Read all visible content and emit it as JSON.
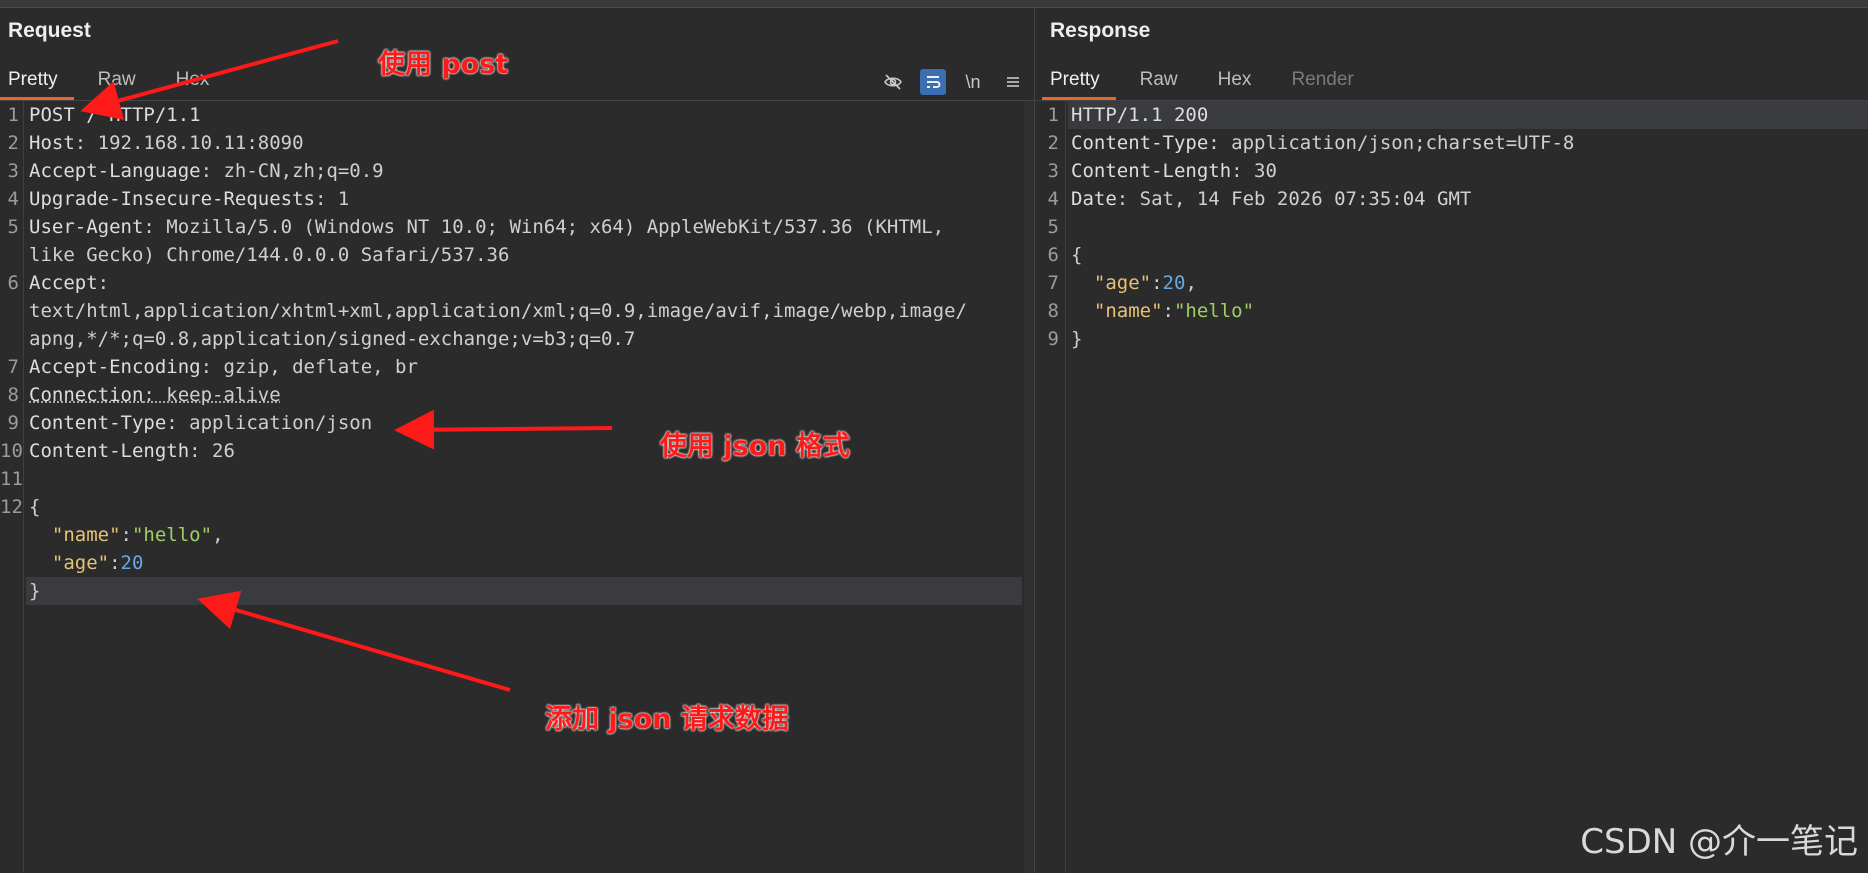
{
  "request": {
    "title": "Request",
    "tabs": [
      "Pretty",
      "Raw",
      "Hex"
    ],
    "toolbar": {
      "hide_icon": "eye-off-icon",
      "wrap_icon": "wrap-icon",
      "newline_label": "\\n",
      "menu_icon": "menu-icon"
    },
    "lines": [
      {
        "n": "1",
        "parts": [
          {
            "c": "k",
            "t": "POST / HTTP/1.1"
          }
        ]
      },
      {
        "n": "2",
        "parts": [
          {
            "c": "k",
            "t": "Host"
          },
          {
            "c": "v",
            "t": ": 192.168.10.11:8090"
          }
        ]
      },
      {
        "n": "3",
        "parts": [
          {
            "c": "k",
            "t": "Accept-Language"
          },
          {
            "c": "v",
            "t": ": zh-CN,zh;q=0.9"
          }
        ]
      },
      {
        "n": "4",
        "parts": [
          {
            "c": "k",
            "t": "Upgrade-Insecure-Requests"
          },
          {
            "c": "v",
            "t": ": 1"
          }
        ]
      },
      {
        "n": "5",
        "parts": [
          {
            "c": "k",
            "t": "User-Agent"
          },
          {
            "c": "v",
            "t": ": Mozilla/5.0 (Windows NT 10.0; Win64; x64) AppleWebKit/537.36 (KHTML,"
          }
        ]
      },
      {
        "n": "",
        "parts": [
          {
            "c": "v",
            "t": "like Gecko) Chrome/144.0.0.0 Safari/537.36"
          }
        ]
      },
      {
        "n": "6",
        "parts": [
          {
            "c": "k",
            "t": "Accept"
          },
          {
            "c": "v",
            "t": ":"
          }
        ]
      },
      {
        "n": "",
        "parts": [
          {
            "c": "v",
            "t": "text/html,application/xhtml+xml,application/xml;q=0.9,image/avif,image/webp,image/"
          }
        ]
      },
      {
        "n": "",
        "parts": [
          {
            "c": "v",
            "t": "apng,*/*;q=0.8,application/signed-exchange;v=b3;q=0.7"
          }
        ]
      },
      {
        "n": "7",
        "parts": [
          {
            "c": "k",
            "t": "Accept-Encoding"
          },
          {
            "c": "v",
            "t": ": gzip, deflate, br"
          }
        ]
      },
      {
        "n": "8",
        "parts": [
          {
            "c": "k dotted",
            "t": "Connection"
          },
          {
            "c": "v dotted",
            "t": ": keep-alive"
          }
        ]
      },
      {
        "n": "9",
        "parts": [
          {
            "c": "k",
            "t": "Content-Type"
          },
          {
            "c": "v",
            "t": ": application/json"
          }
        ]
      },
      {
        "n": "10",
        "parts": [
          {
            "c": "k",
            "t": "Content-Length"
          },
          {
            "c": "v",
            "t": ": 26"
          }
        ]
      },
      {
        "n": "11",
        "parts": []
      },
      {
        "n": "12",
        "parts": [
          {
            "c": "v",
            "t": "{"
          }
        ]
      },
      {
        "n": "",
        "parts": [
          {
            "c": "v",
            "t": "  "
          },
          {
            "c": "key",
            "t": "\"name\""
          },
          {
            "c": "v",
            "t": ":"
          },
          {
            "c": "str",
            "t": "\"hello\""
          },
          {
            "c": "v",
            "t": ","
          }
        ]
      },
      {
        "n": "",
        "parts": [
          {
            "c": "v",
            "t": "  "
          },
          {
            "c": "key",
            "t": "\"age\""
          },
          {
            "c": "v",
            "t": ":"
          },
          {
            "c": "num",
            "t": "20"
          }
        ]
      },
      {
        "n": "",
        "parts": [
          {
            "c": "v",
            "t": "}"
          }
        ],
        "highlight": true
      }
    ]
  },
  "response": {
    "title": "Response",
    "tabs": [
      "Pretty",
      "Raw",
      "Hex",
      "Render"
    ],
    "lines": [
      {
        "n": "1",
        "parts": [
          {
            "c": "k",
            "t": "HTTP/1.1 200"
          }
        ],
        "highlight": true
      },
      {
        "n": "2",
        "parts": [
          {
            "c": "k",
            "t": "Content-Type"
          },
          {
            "c": "v",
            "t": ": application/json;charset=UTF-8"
          }
        ]
      },
      {
        "n": "3",
        "parts": [
          {
            "c": "k",
            "t": "Content-Length"
          },
          {
            "c": "v",
            "t": ": 30"
          }
        ]
      },
      {
        "n": "4",
        "parts": [
          {
            "c": "k",
            "t": "Date"
          },
          {
            "c": "v",
            "t": ": Sat, 14 Feb 2026 07:35:04 GMT"
          }
        ]
      },
      {
        "n": "5",
        "parts": []
      },
      {
        "n": "6",
        "parts": [
          {
            "c": "v",
            "t": "{"
          }
        ]
      },
      {
        "n": "7",
        "parts": [
          {
            "c": "v",
            "t": "  "
          },
          {
            "c": "key",
            "t": "\"age\""
          },
          {
            "c": "v",
            "t": ":"
          },
          {
            "c": "num",
            "t": "20"
          },
          {
            "c": "v",
            "t": ","
          }
        ]
      },
      {
        "n": "8",
        "parts": [
          {
            "c": "v",
            "t": "  "
          },
          {
            "c": "key",
            "t": "\"name\""
          },
          {
            "c": "v",
            "t": ":"
          },
          {
            "c": "str",
            "t": "\"hello\""
          }
        ]
      },
      {
        "n": "9",
        "parts": [
          {
            "c": "v",
            "t": "}"
          }
        ]
      }
    ]
  },
  "annotations": {
    "post": "使用 post",
    "json_format": "使用 json 格式",
    "json_data": "添加 json 请求数据"
  },
  "watermark": "CSDN @介一笔记",
  "colors": {
    "accent": "#e8672b",
    "annotation": "#ff1a1a"
  }
}
